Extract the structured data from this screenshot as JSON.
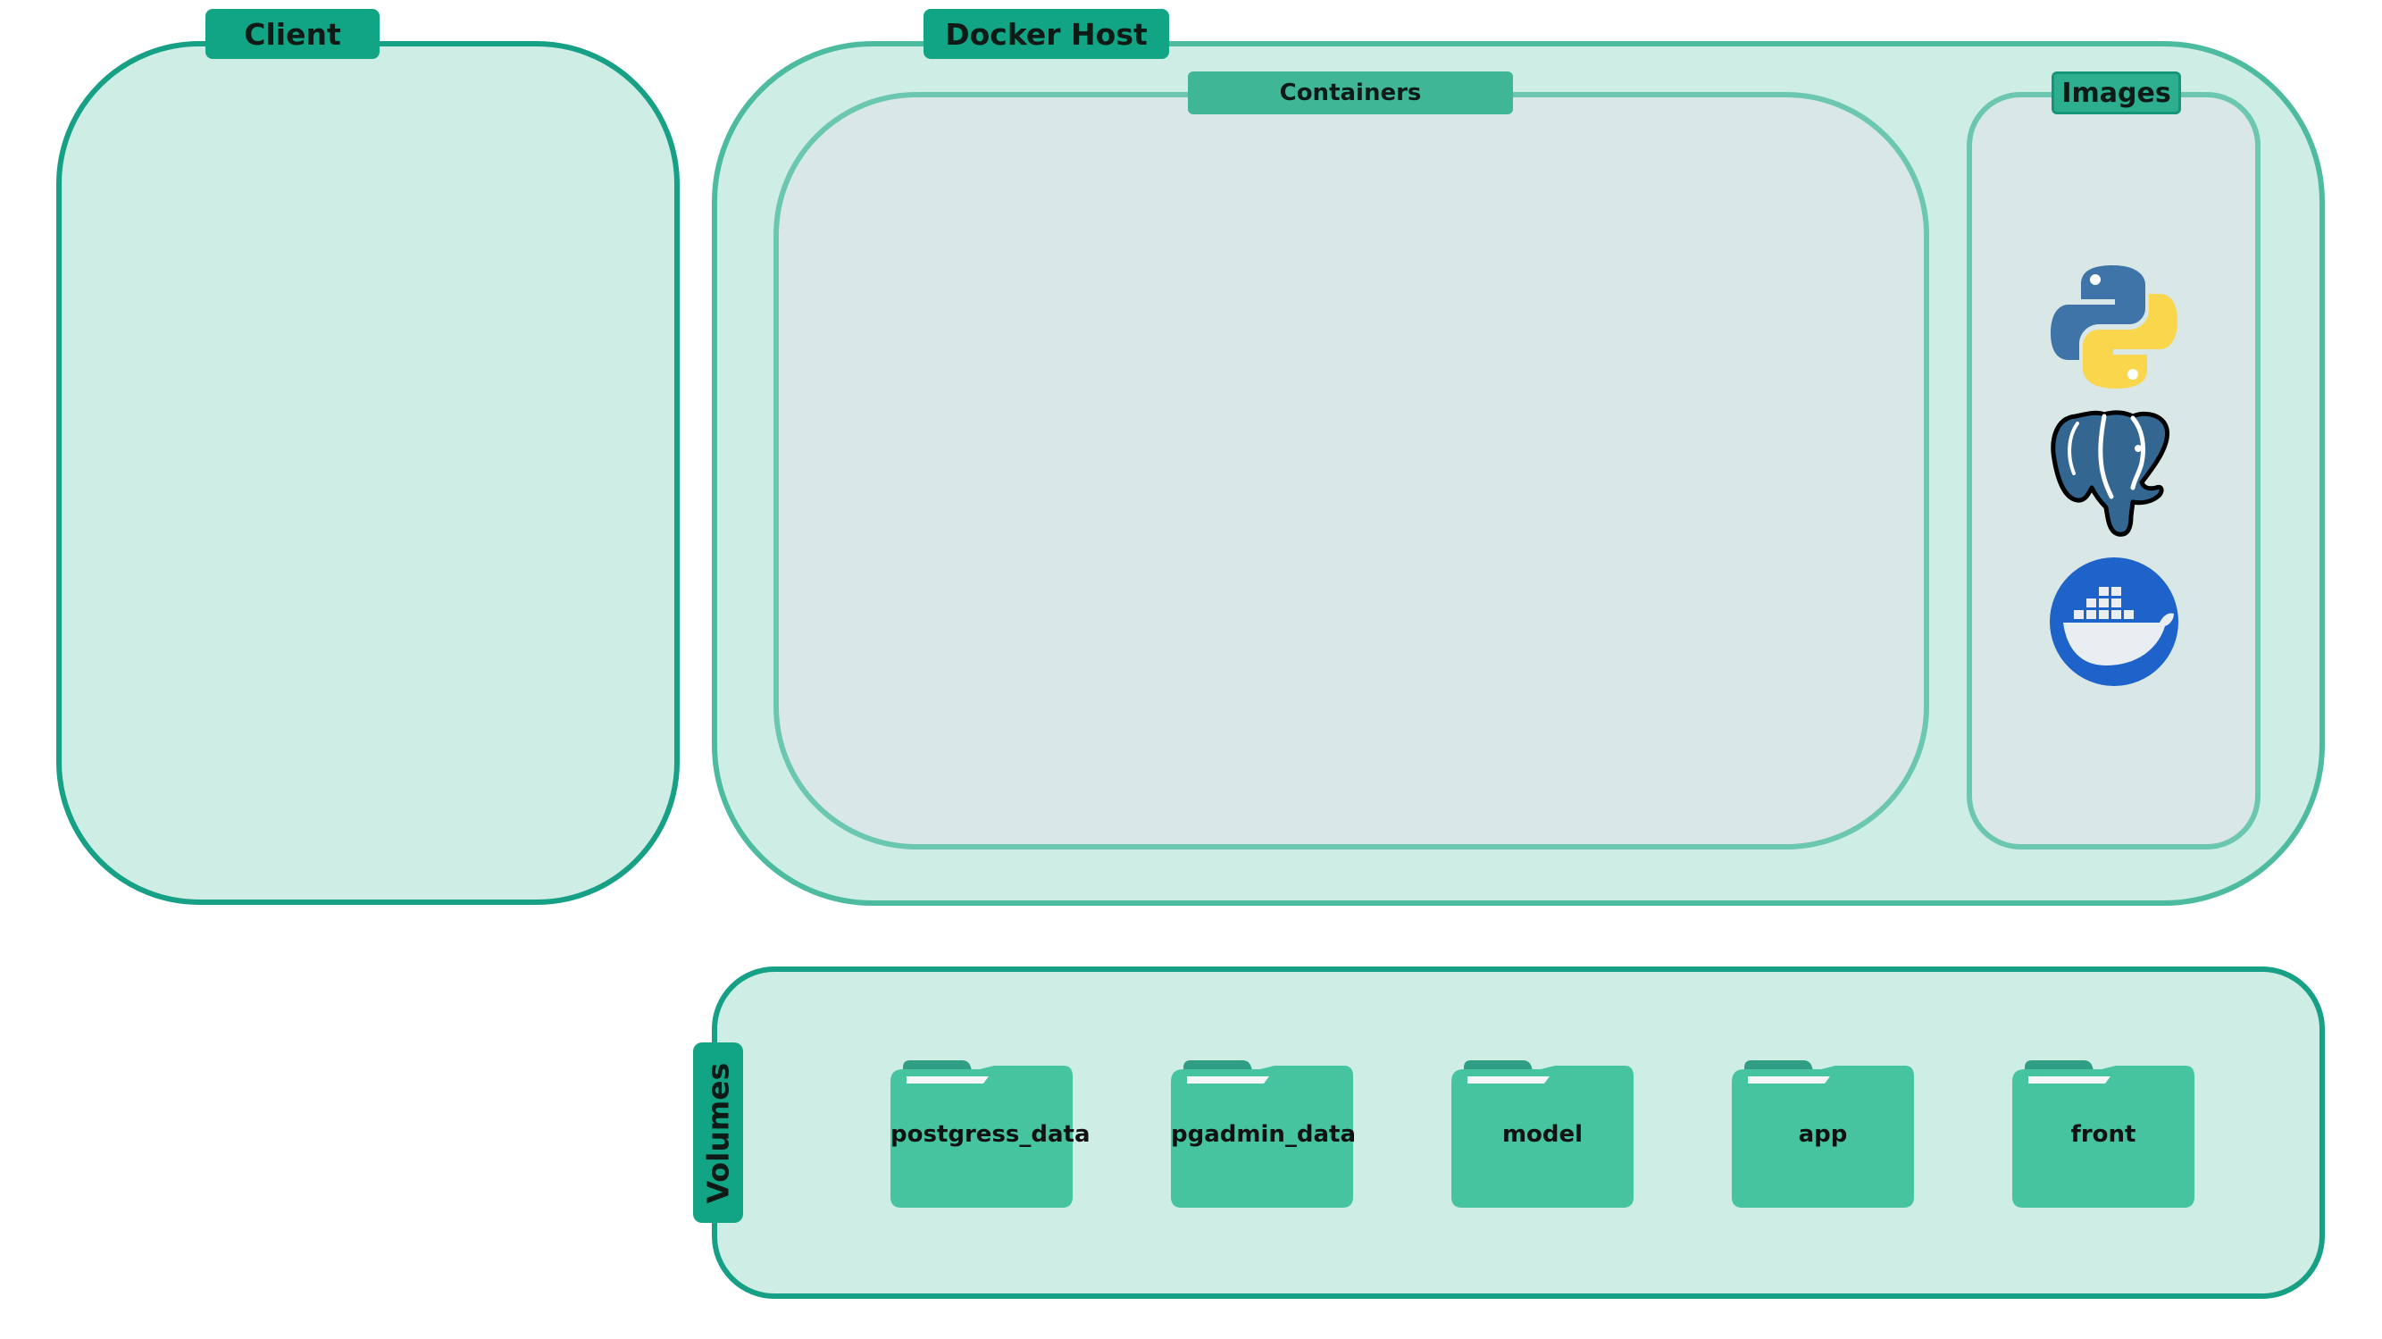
{
  "client": {
    "label": "Client"
  },
  "docker_host": {
    "label": "Docker Host",
    "containers": {
      "label": "Containers"
    },
    "images": {
      "label": "Images",
      "items": [
        "python-logo",
        "postgresql-logo",
        "docker-logo"
      ]
    }
  },
  "volumes": {
    "label": "Volumes",
    "folders": [
      "postgress_data",
      "pgadmin_data",
      "model",
      "app",
      "front"
    ]
  },
  "colors": {
    "panel_fill": "#ceede5",
    "panel_border": "#16a085",
    "tab_fill": "#12a585",
    "folder_fill": "#45c49f",
    "folder_tab": "#2f9e85"
  }
}
